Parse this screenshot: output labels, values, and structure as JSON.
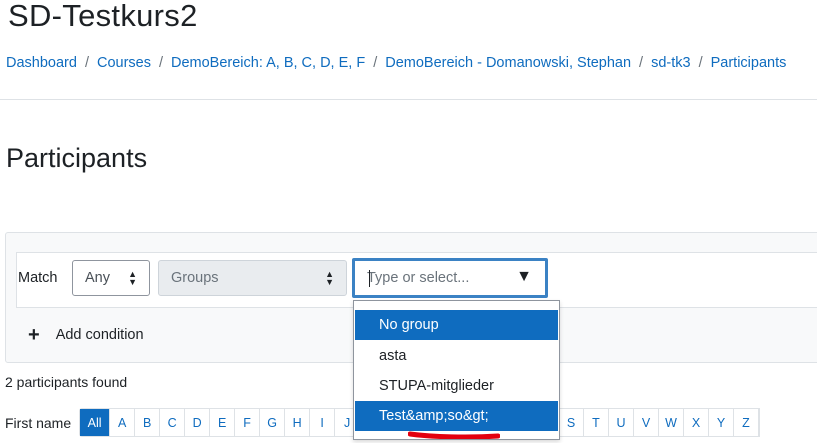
{
  "course_title": "SD-Testkurs2",
  "breadcrumb": [
    "Dashboard",
    "Courses",
    "DemoBereich: A, B, C, D, E, F",
    "DemoBereich - Domanowski, Stephan",
    "sd-tk3",
    "Participants"
  ],
  "breadcrumb_separator": "/",
  "page_title": "Participants",
  "filter": {
    "match_label": "Match",
    "match_value": "Any",
    "type_value": "Groups",
    "autocomplete_placeholder": "Type or select...",
    "add_condition_label": "Add condition",
    "options": [
      "No group",
      "asta",
      "STUPA-mitglieder",
      "Test&amp;so&gt;"
    ],
    "highlighted_options": [
      "No group",
      "Test&amp;so&gt;"
    ]
  },
  "participants_found": "2 participants found",
  "initials": {
    "label": "First name",
    "all_label": "All",
    "letters_left": [
      "A",
      "B",
      "C",
      "D",
      "E",
      "F",
      "G",
      "H",
      "I",
      "J"
    ],
    "letters_right": [
      "S",
      "T",
      "U",
      "V",
      "W",
      "X",
      "Y",
      "Z"
    ]
  },
  "colors": {
    "link": "#0f6cbf",
    "highlight": "#0f6cbf",
    "focus_border": "#3b82c4",
    "annotation": "#e3000f"
  }
}
